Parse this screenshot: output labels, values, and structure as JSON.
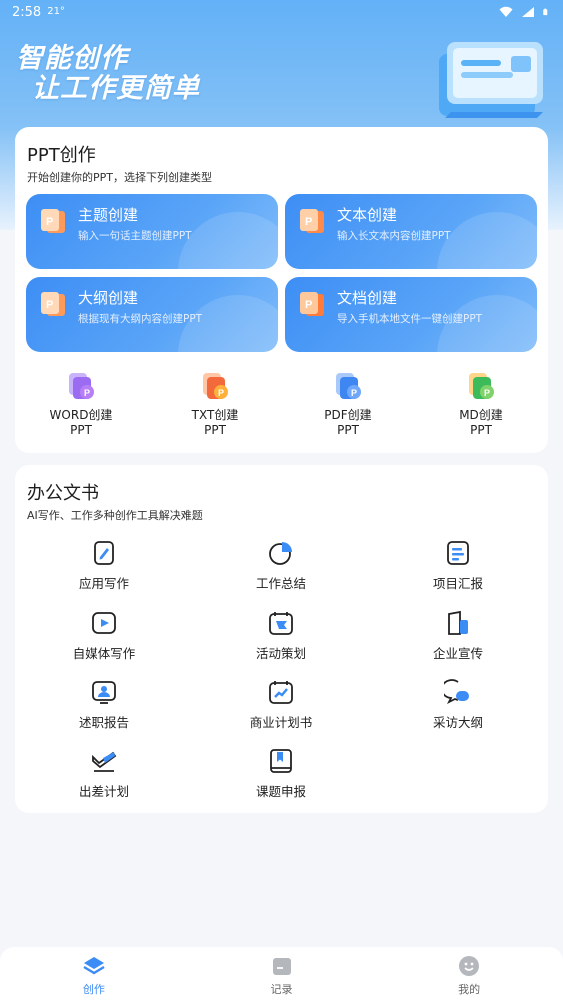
{
  "status_bar": {
    "time": "2:58",
    "temp": "21°"
  },
  "hero": {
    "line1": "智能创作",
    "line2": "让工作更简单"
  },
  "ppt_section": {
    "title": "PPT创作",
    "subtitle": "开始创建你的PPT，选择下列创建类型",
    "tiles": [
      {
        "name": "主题创建",
        "desc": "输入一句话主题创建PPT",
        "icon": "ppt-topic-icon"
      },
      {
        "name": "文本创建",
        "desc": "输入长文本内容创建PPT",
        "icon": "ppt-text-icon"
      },
      {
        "name": "大纲创建",
        "desc": "根据现有大纲内容创建PPT",
        "icon": "ppt-outline-icon"
      },
      {
        "name": "文档创建",
        "desc": "导入手机本地文件一键创建PPT",
        "icon": "ppt-document-icon"
      }
    ],
    "converters": [
      {
        "line1": "WORD创建",
        "line2": "PPT",
        "icon": "word-ppt-icon",
        "color": "#9b6cf2"
      },
      {
        "line1": "TXT创建",
        "line2": "PPT",
        "icon": "txt-ppt-icon",
        "color": "#f26a3c"
      },
      {
        "line1": "PDF创建",
        "line2": "PPT",
        "icon": "pdf-ppt-icon",
        "color": "#3e86f2"
      },
      {
        "line1": "MD创建",
        "line2": "PPT",
        "icon": "md-ppt-icon",
        "color": "#3dbb5a"
      }
    ]
  },
  "office_section": {
    "title": "办公文书",
    "subtitle": "AI写作、工作多种创作工具解决难题",
    "items": [
      {
        "label": "应用写作",
        "icon": "pen-doc-icon"
      },
      {
        "label": "工作总结",
        "icon": "pie-chart-icon"
      },
      {
        "label": "项目汇报",
        "icon": "list-board-icon"
      },
      {
        "label": "自媒体写作",
        "icon": "video-play-icon"
      },
      {
        "label": "活动策划",
        "icon": "calendar-flag-icon"
      },
      {
        "label": "企业宣传",
        "icon": "building-icon"
      },
      {
        "label": "述职报告",
        "icon": "person-screen-icon"
      },
      {
        "label": "商业计划书",
        "icon": "trend-calendar-icon"
      },
      {
        "label": "采访大纲",
        "icon": "chat-bubble-icon"
      },
      {
        "label": "出差计划",
        "icon": "plane-icon"
      },
      {
        "label": "课题申报",
        "icon": "book-icon"
      }
    ]
  },
  "tabs": [
    {
      "label": "创作",
      "icon": "create-layers-icon",
      "active": true
    },
    {
      "label": "记录",
      "icon": "folder-icon",
      "active": false
    },
    {
      "label": "我的",
      "icon": "smiley-icon",
      "active": false
    }
  ],
  "colors": {
    "primary": "#3b8cf5",
    "hero_top": "#63b1f7",
    "background": "#f4f6fa"
  }
}
